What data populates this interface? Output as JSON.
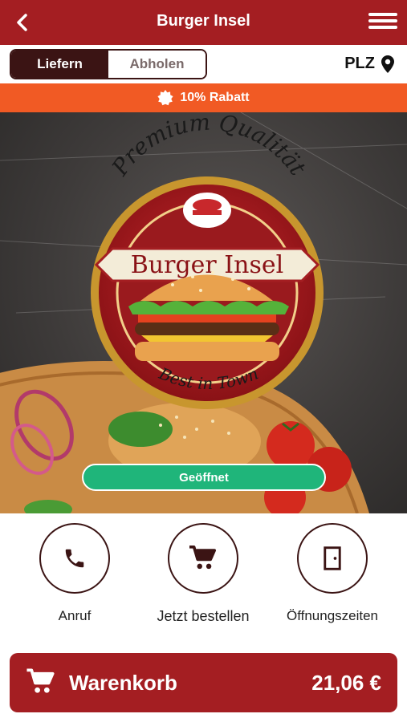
{
  "header": {
    "title": "Burger Insel",
    "back_icon": "chevron-left-icon",
    "menu_icon": "hamburger-menu-icon"
  },
  "mode_toggle": {
    "options": [
      "Liefern",
      "Abholen"
    ],
    "selected": "Liefern"
  },
  "location": {
    "label": "PLZ",
    "icon": "map-pin-icon"
  },
  "discount": {
    "text": "10% Rabatt",
    "icon": "badge-icon",
    "color": "#f15a24"
  },
  "hero": {
    "logo": {
      "arc_text": "Premium Qualität",
      "brand": "Burger Insel",
      "tagline": "Best in Town"
    },
    "status_button": "Geöffnet",
    "status_color": "#1fb57a"
  },
  "actions": [
    {
      "label": "Anruf",
      "icon": "phone-icon"
    },
    {
      "label": "Jetzt bestellen",
      "icon": "cart-icon"
    },
    {
      "label": "Öffnungszeiten",
      "icon": "door-icon"
    }
  ],
  "cart": {
    "label": "Warenkorb",
    "total": "21,06 €",
    "icon": "cart-icon"
  },
  "colors": {
    "brand": "#a41e22",
    "dark": "#3b1414"
  }
}
